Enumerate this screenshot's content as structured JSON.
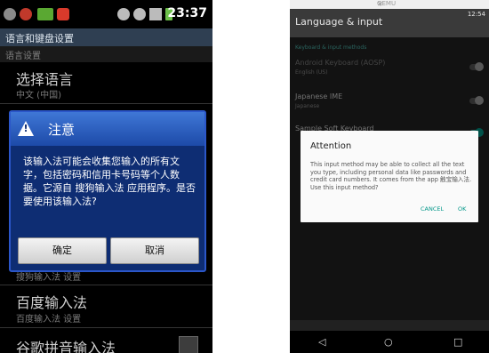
{
  "left_phone": {
    "status_time": "23:37",
    "header_title": "语言和键盘设置",
    "section_label": "语言设置",
    "select_language": {
      "title": "选择语言",
      "subtitle": "中文 (中国)"
    },
    "sogou_settings": "搜狗输入法 设置",
    "baidu": {
      "title": "百度输入法",
      "subtitle": "百度输入法 设置"
    },
    "google_pinyin_title": "谷歌拼音输入法",
    "dialog": {
      "title": "注意",
      "message": "该输入法可能会收集您输入的所有文字，包括密码和信用卡号码等个人数据。它源自 搜狗输入法 应用程序。是否要使用该输入法?",
      "ok": "确定",
      "cancel": "取消"
    }
  },
  "right_phone": {
    "window_title": "QEMU",
    "status_time": "12:54",
    "app_title": "Language & input",
    "section": "Keyboard & input methods",
    "prefs": [
      {
        "title": "Android Keyboard (AOSP)",
        "subtitle": "English (US)"
      },
      {
        "title": "Japanese IME",
        "subtitle": "Japanese"
      },
      {
        "title": "Sample Soft Keyboard",
        "subtitle": ""
      }
    ],
    "dialog": {
      "title": "Attention",
      "message": "This input method may be able to collect all the text you type, including personal data like passwords and credit card numbers. It comes from the app 触宝输入法. Use this input method?",
      "cancel": "CANCEL",
      "ok": "OK"
    },
    "nav": {
      "back": "◁",
      "home": "○",
      "recents": "□"
    }
  },
  "colors": {
    "left_dialog_bg": "#0e2d73",
    "left_dialog_header": "#3f77d6",
    "right_accent": "#009688"
  }
}
